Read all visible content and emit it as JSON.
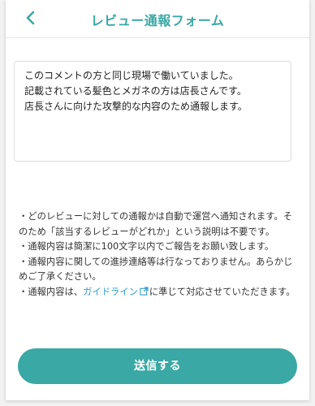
{
  "header": {
    "title": "レビュー通報フォーム"
  },
  "comment": {
    "lines": [
      "このコメントの方と同じ現場で働いていました。",
      "記載されている髪色とメガネの方は店長さんです。",
      "店長さんに向けた攻撃的な内容のため通報します。"
    ]
  },
  "notes": {
    "note1": "・どのレビューに対しての通報かは自動で運営へ通知されます。そのため「該当するレビューがどれか」という説明は不要です。",
    "note2": "・通報内容は簡潔に100文字以内でご報告をお願い致します。",
    "note3": "・通報内容に関しての進捗連絡等は行なっておりません。あらかじめご了承ください。",
    "note4_prefix": "・通報内容は、",
    "note4_link": "ガイドライン",
    "note4_suffix": "に準じて対応させていただきます。"
  },
  "submit": {
    "label": "送信する"
  },
  "colors": {
    "accent": "#3aa8a4",
    "link": "#2f9bd1"
  },
  "icons": {
    "back": "chevron-left-icon",
    "external": "external-link-icon"
  }
}
